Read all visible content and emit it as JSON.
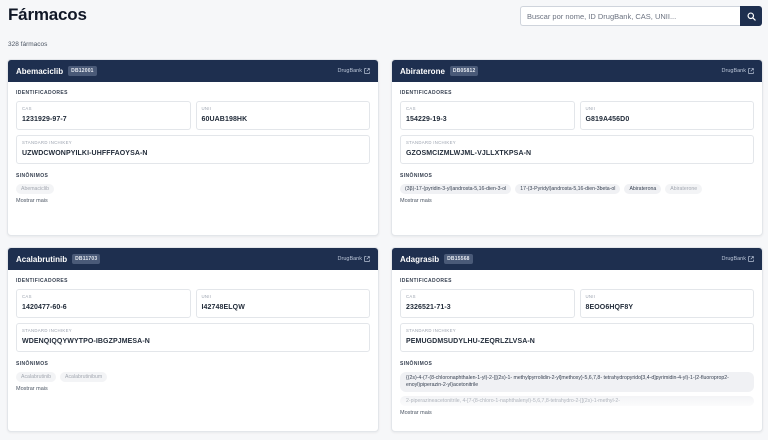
{
  "header": {
    "title": "Fármacos",
    "search_placeholder": "Buscar por nome, ID DrugBank, CAS, UNII...",
    "count_text": "328 fármacos"
  },
  "labels": {
    "identifiers": "IDENTIFICADORES",
    "cas": "CAS",
    "unii": "UNII",
    "inchikey": "STANDARD INCHIKEY",
    "synonyms": "SINÔNIMOS",
    "show_more": "Mostrar mais",
    "drugbank_link": "DrugBank"
  },
  "drugs": [
    {
      "name": "Abemaciclib",
      "id": "DB12001",
      "cas": "1231929-97-7",
      "unii": "60UAB198HK",
      "inchikey": "UZWDCWONPYILKI-UHFFFAOYSA-N",
      "synonyms": [
        "Abemaciclib"
      ]
    },
    {
      "name": "Abiraterone",
      "id": "DB05812",
      "cas": "154229-19-3",
      "unii": "G819A456D0",
      "inchikey": "GZOSMCIZMLWJML-VJLLXTKPSA-N",
      "synonyms": [
        "(3β)-17-(pyridin-3-yl)androsta-5,16-dien-3-ol",
        "17-(3-Pyridyl)androsta-5,16-dien-3beta-ol",
        "Abiraterona",
        "Abiraterone"
      ]
    },
    {
      "name": "Acalabrutinib",
      "id": "DB11703",
      "cas": "1420477-60-6",
      "unii": "I42748ELQW",
      "inchikey": "WDENQIQQYWYTPO-IBGZPJMESA-N",
      "synonyms": [
        "Acalabrutinib",
        "Acalabrutinibum"
      ]
    },
    {
      "name": "Adagrasib",
      "id": "DB15568",
      "cas": "2326521-71-3",
      "unii": "8EOO6HQF8Y",
      "inchikey": "PEMUGDMSUDYLHU-ZEQRLZLVSA-N",
      "synonyms": [
        "{(2s)-4-(7-(8-chloronaphthalen-1-yl)-2-{[(2s)-1- methylpyrrolidin-2-yl]methoxy}-5,6,7,8- tetrahydropyrido[3,4-d]pyrimidin-4-yl)-1-(2-fluoroprop2-enoyl)piperazin-2-yl}acetonitrile",
        "2-piperazineacetonitrile, 4-[7-(8-chloro-1-naphthalenyl)-5,6,7,8-tetrahydro-2-[[(2s)-1-methyl-2-"
      ]
    }
  ]
}
